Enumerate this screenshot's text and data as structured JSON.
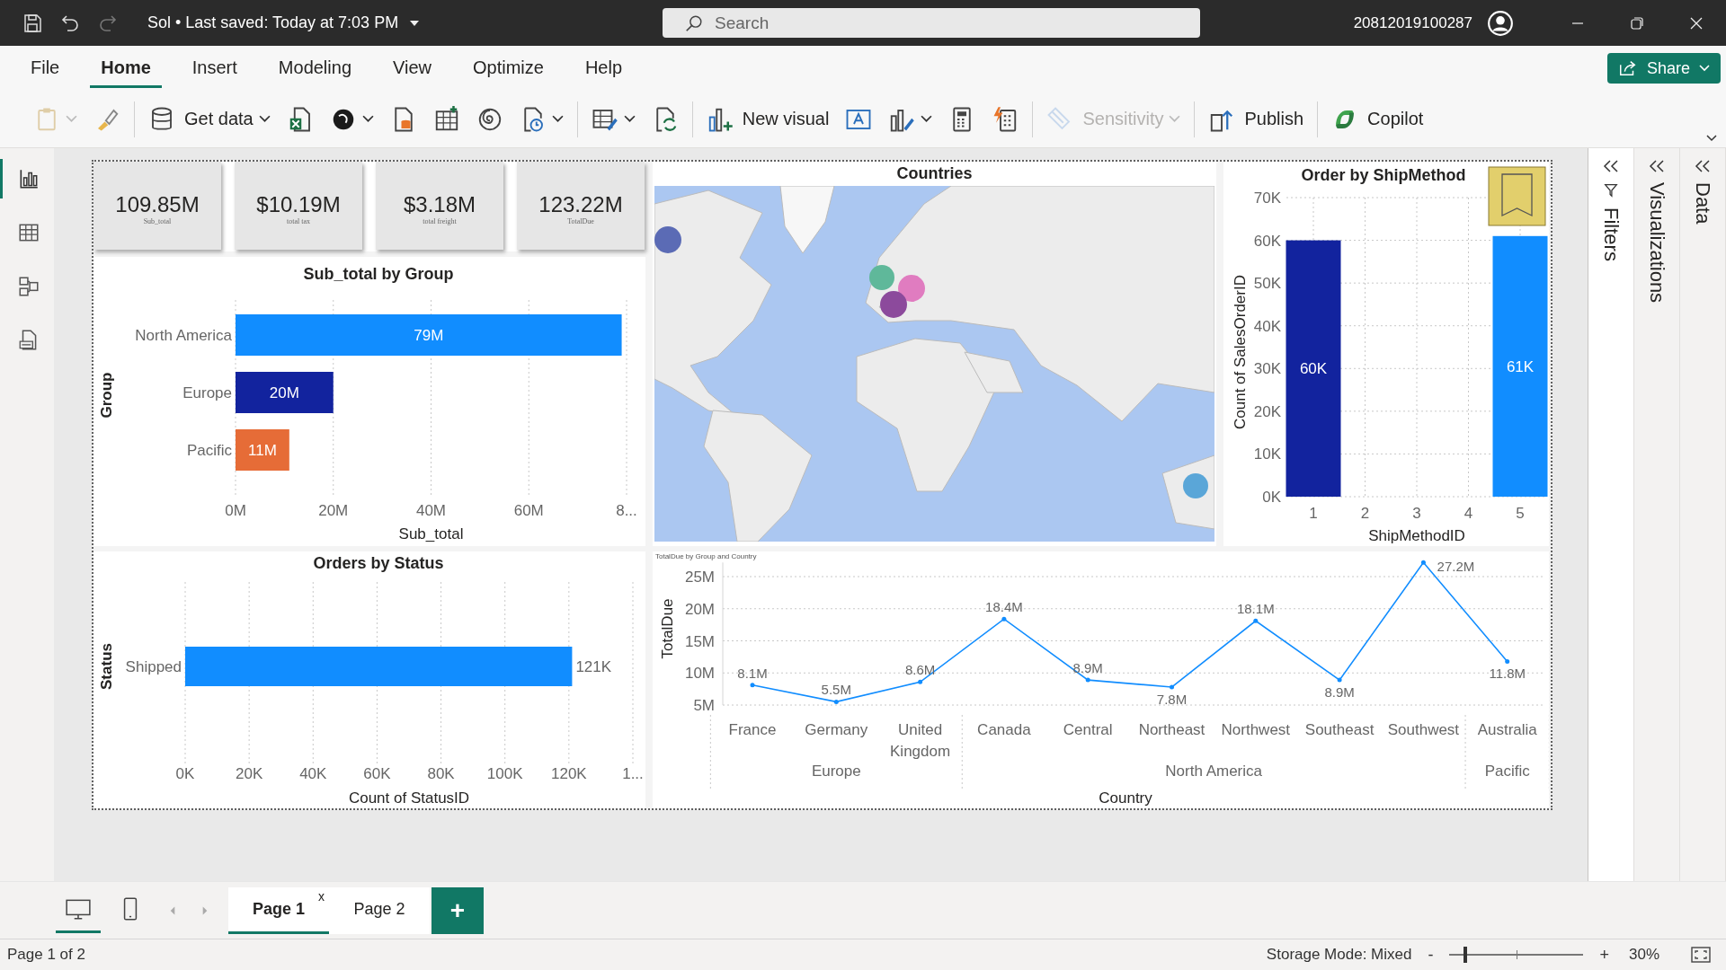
{
  "title_bar": {
    "document": "Sol • Last saved: Today at 7:03 PM",
    "search": {
      "placeholder": "Search"
    },
    "account": "20812019100287"
  },
  "menu_tabs": [
    {
      "label": "File",
      "selected": false
    },
    {
      "label": "Home",
      "selected": true
    },
    {
      "label": "Insert",
      "selected": false
    },
    {
      "label": "Modeling",
      "selected": false
    },
    {
      "label": "View",
      "selected": false
    },
    {
      "label": "Optimize",
      "selected": false
    },
    {
      "label": "Help",
      "selected": false
    }
  ],
  "share": "Share",
  "ribbon": [
    {
      "dropdown": true,
      "disabled": true
    },
    {
      "dropdown": false,
      "disabled": false
    },
    {
      "label": "Get data",
      "dropdown": true,
      "disabled": false
    },
    {
      "dropdown": false,
      "disabled": false
    },
    {
      "dropdown": true,
      "disabled": false
    },
    {
      "dropdown": false,
      "disabled": false
    },
    {
      "dropdown": false,
      "disabled": false
    },
    {
      "dropdown": false,
      "disabled": false
    },
    {
      "dropdown": true,
      "disabled": false
    },
    {
      "dropdown": true,
      "disabled": false
    },
    {
      "dropdown": false,
      "disabled": false
    },
    {
      "label": "New visual",
      "dropdown": false,
      "disabled": false
    },
    {
      "dropdown": false,
      "disabled": false
    },
    {
      "dropdown": true,
      "disabled": false
    },
    {
      "dropdown": false,
      "disabled": false
    },
    {
      "dropdown": false,
      "disabled": false
    },
    {
      "label": "Sensitivity",
      "dropdown": true,
      "disabled": true
    },
    {
      "label": "Publish",
      "dropdown": false,
      "disabled": false
    },
    {
      "label": "Copilot",
      "dropdown": false,
      "disabled": false
    }
  ],
  "view_switcher": [
    {
      "selected": true
    },
    {
      "selected": false
    },
    {
      "selected": false
    },
    {
      "selected": false
    }
  ],
  "kpi_cards": [
    {
      "value": "109.85M",
      "label": "Sub_total"
    },
    {
      "value": "$10.19M",
      "label": "total tax"
    },
    {
      "value": "$3.18M",
      "label": "total freight"
    },
    {
      "value": "123.22M",
      "label": "TotalDue"
    }
  ],
  "visuals": {
    "subtotal_by_group": {
      "chart_data": {
        "type": "bar",
        "orientation": "horizontal",
        "title": "Sub_total by Group",
        "xlabel": "Sub_total",
        "ylabel": "Group",
        "categories": [
          "North America",
          "Europe",
          "Pacific"
        ],
        "grid": true,
        "xlim": [
          0,
          80
        ],
        "series": [
          {
            "color": "#118dff",
            "values": [
              79,
              null,
              null
            ]
          },
          {
            "color": "#12239e",
            "values": [
              null,
              20,
              null
            ]
          },
          {
            "color": "#e66c37",
            "values": [
              null,
              null,
              11
            ]
          }
        ],
        "xticks": [
          {
            "value": 0,
            "label": "0M"
          },
          {
            "value": 20,
            "label": "20M"
          },
          {
            "value": 40,
            "label": "40M"
          },
          {
            "value": 60,
            "label": "60M"
          },
          {
            "value": 80,
            "label": "8..."
          }
        ],
        "value_labels": [
          "79M",
          "20M",
          "11M"
        ]
      }
    },
    "orders_by_status": {
      "chart_data": {
        "type": "bar",
        "orientation": "horizontal",
        "title": "Orders by Status",
        "xlabel": "Count of StatusID",
        "ylabel": "Status",
        "categories": [
          "Shipped"
        ],
        "grid": true,
        "xlim": [
          0,
          140
        ],
        "series": [
          {
            "color": "#118dff",
            "values": [
              121
            ]
          }
        ],
        "xticks": [
          {
            "value": 0,
            "label": "0K"
          },
          {
            "value": 20,
            "label": "20K"
          },
          {
            "value": 40,
            "label": "40K"
          },
          {
            "value": 60,
            "label": "60K"
          },
          {
            "value": 80,
            "label": "80K"
          },
          {
            "value": 100,
            "label": "100K"
          },
          {
            "value": 120,
            "label": "120K"
          },
          {
            "value": 140,
            "label": "1..."
          }
        ],
        "value_labels": [
          "121K"
        ]
      }
    },
    "countries_map": {
      "title": "Countries",
      "kind": "picture"
    },
    "order_by_shipmethod": {
      "chart_data": {
        "type": "bar",
        "orientation": "vertical",
        "title": "Order by ShipMethod",
        "xlabel": "ShipMethodID",
        "ylabel": "Count of SalesOrderID",
        "categories": [
          "1",
          "2",
          "3",
          "4",
          "5"
        ],
        "grid": true,
        "ylim": [
          0,
          70
        ],
        "series": [
          {
            "color": "#12239e",
            "values": [
              60,
              null,
              null,
              null,
              null
            ]
          },
          {
            "color": "#118dff",
            "values": [
              null,
              null,
              null,
              null,
              61
            ]
          }
        ],
        "yticks": [
          {
            "value": 0,
            "label": "0K"
          },
          {
            "value": 10,
            "label": "10K"
          },
          {
            "value": 20,
            "label": "20K"
          },
          {
            "value": 30,
            "label": "30K"
          },
          {
            "value": 40,
            "label": "40K"
          },
          {
            "value": 50,
            "label": "50K"
          },
          {
            "value": 60,
            "label": "60K"
          },
          {
            "value": 70,
            "label": "70K"
          }
        ],
        "value_labels": [
          "60K",
          null,
          null,
          null,
          "61K"
        ]
      }
    },
    "totaldue_by_country": {
      "chart_data": {
        "type": "line",
        "title": "TotalDue by Group and Country",
        "xlabel": "Country",
        "ylabel": "TotalDue",
        "categories": [
          "France",
          "Germany",
          "United Kingdom",
          "Canada",
          "Central",
          "Northeast",
          "Northwest",
          "Southeast",
          "Southwest",
          "Australia"
        ],
        "grid": true,
        "ylim": [
          5,
          27.2
        ],
        "series": [
          {
            "color": "#118dff",
            "values": [
              8.1,
              5.5,
              8.6,
              18.4,
              8.9,
              7.8,
              18.1,
              8.9,
              27.2,
              11.8
            ]
          }
        ],
        "yticks": [
          {
            "value": 5,
            "label": "5M"
          },
          {
            "value": 10,
            "label": "10M"
          },
          {
            "value": 15,
            "label": "15M"
          },
          {
            "value": 20,
            "label": "20M"
          },
          {
            "value": 25,
            "label": "25M"
          }
        ],
        "value_labels": [
          "8.1M",
          "5.5M",
          "8.6M",
          "18.4M",
          "8.9M",
          "7.8M",
          "18.1M",
          "8.9M",
          "27.2M",
          "11.8M"
        ],
        "annotations": [
          "Europe",
          "North America",
          "Pacific"
        ]
      }
    }
  },
  "bookmark": {
    "highlighted": true
  },
  "panes": [
    {
      "label": "Filters"
    },
    {
      "label": "Visualizations"
    },
    {
      "label": "Data"
    }
  ],
  "layout_buttons": [
    {
      "selected": true
    },
    {
      "selected": false
    }
  ],
  "page_tabs": [
    {
      "label": "Page 1",
      "selected": true,
      "close": "x"
    },
    {
      "label": "Page 2",
      "selected": false
    }
  ],
  "add_page": "+",
  "status_bar": {
    "pages": "Page 1 of 2",
    "storage_mode": "Storage Mode: Mixed",
    "zoom_out": "-",
    "zoom_in": "+",
    "zoom": {
      "level": 0.12,
      "reading": "30%"
    }
  }
}
